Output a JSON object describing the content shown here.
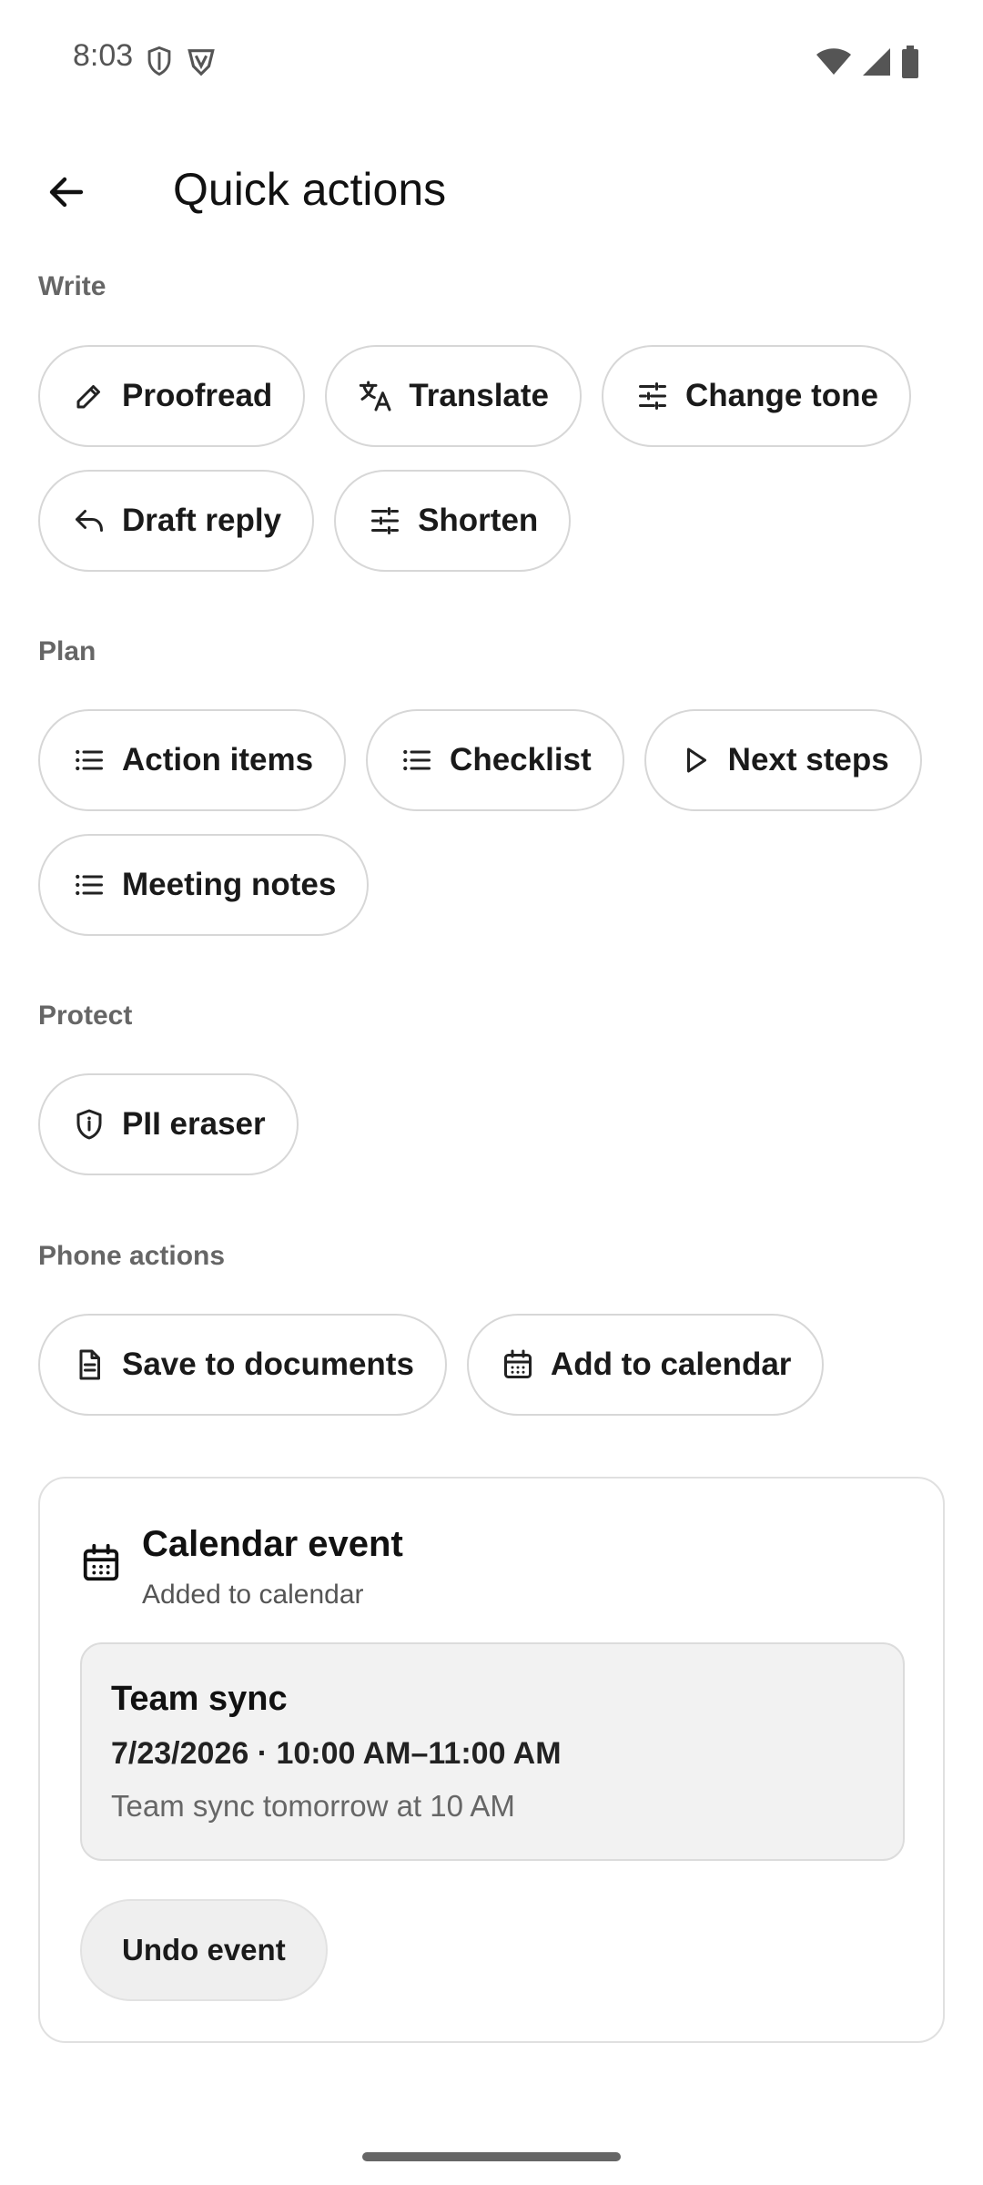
{
  "status_bar": {
    "time": "8:03",
    "left_icons": [
      "shield-status-icon",
      "vpn-status-icon"
    ],
    "right_icons": [
      "wifi-icon",
      "signal-icon",
      "battery-icon"
    ]
  },
  "app_bar": {
    "title": "Quick actions",
    "back_icon": "arrow-back-icon"
  },
  "sections": {
    "write": {
      "label": "Write",
      "chips": [
        {
          "label": "Proofread",
          "icon": "pencil-icon"
        },
        {
          "label": "Translate",
          "icon": "translate-icon"
        },
        {
          "label": "Change tone",
          "icon": "tune-icon"
        },
        {
          "label": "Draft reply",
          "icon": "reply-icon"
        },
        {
          "label": "Shorten",
          "icon": "tune-icon"
        }
      ]
    },
    "plan": {
      "label": "Plan",
      "chips": [
        {
          "label": "Action items",
          "icon": "list-icon"
        },
        {
          "label": "Checklist",
          "icon": "list-icon"
        },
        {
          "label": "Next steps",
          "icon": "play-icon"
        },
        {
          "label": "Meeting notes",
          "icon": "list-icon"
        }
      ]
    },
    "protect": {
      "label": "Protect",
      "chips": [
        {
          "label": "PII eraser",
          "icon": "shield-icon"
        }
      ]
    },
    "phone_actions": {
      "label": "Phone actions",
      "chips": [
        {
          "label": "Save to documents",
          "icon": "document-icon"
        },
        {
          "label": "Add to calendar",
          "icon": "calendar-icon"
        }
      ]
    }
  },
  "calendar_card": {
    "title": "Calendar event",
    "subtitle": "Added to calendar",
    "icon": "calendar-icon",
    "event": {
      "title": "Team sync",
      "time": "7/23/2026 · 10:00 AM–11:00 AM",
      "description": "Team sync tomorrow at 10 AM"
    },
    "undo_label": "Undo event"
  },
  "colors": {
    "background": "#ffffff",
    "chip_border": "#d7d7d7",
    "section_label": "#666666",
    "event_box_bg": "#f2f2f2"
  }
}
